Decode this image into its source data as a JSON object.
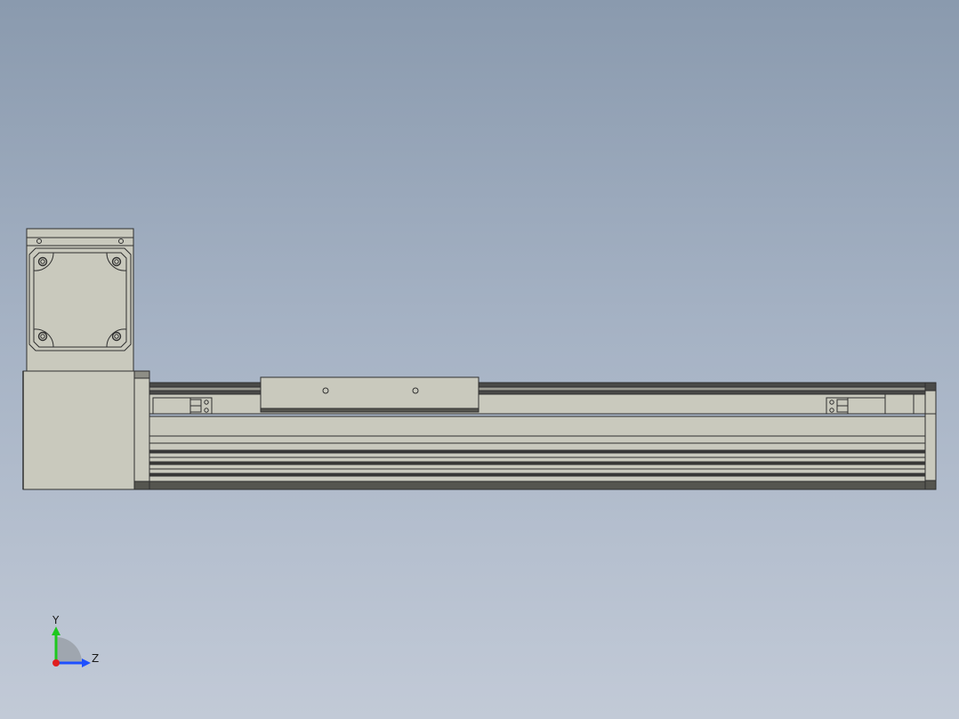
{
  "viewport": {
    "background_top": "#8a9aae",
    "background_bottom": "#c2cad7"
  },
  "model": {
    "body_color": "#c9c9bd",
    "edge_color": "#2f2f2f",
    "dark_strip_color": "#4a4a48",
    "parts": [
      "motor",
      "motor-flange",
      "linear-rail",
      "carriage",
      "left-limit-sensor",
      "right-limit-sensor",
      "end-cap"
    ]
  },
  "triad": {
    "y_label": "Y",
    "z_label": "Z",
    "y_color": "#1ec81e",
    "z_color": "#1e50ff",
    "x_color": "#e01e1e"
  }
}
